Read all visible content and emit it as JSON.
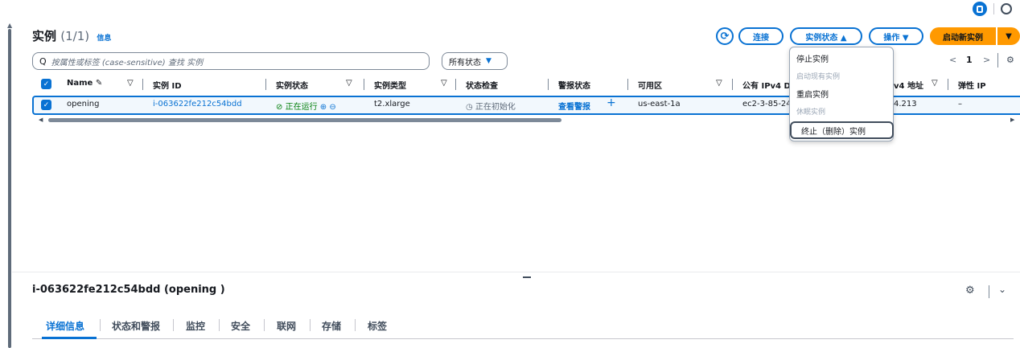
{
  "instances_title": "实例",
  "instances_count": "(1/1)",
  "info_label": "信息",
  "buttons": {
    "refresh": "⟳",
    "connect": "连接",
    "instance_state": "实例状态 ▲",
    "actions": "操作 ▼",
    "launch": "启动新实例",
    "launch_caret": "▼"
  },
  "search": {
    "icon": "search-icon",
    "placeholder": "按属性或标签 (case-sensitive) 查找 实例"
  },
  "state_filter": {
    "label": "所有状态",
    "caret": "▼"
  },
  "pager": {
    "prev": "<",
    "page": "1",
    "next": ">"
  },
  "columns": [
    "Name",
    "实例 ID",
    "实例状态",
    "实例类型",
    "状态检查",
    "警报状态",
    "可用区",
    "公有 IPv4 D",
    "v4 地址",
    "弹性 IP"
  ],
  "row": {
    "name": "opening",
    "instance_id": "i-063622fe212c54bdd",
    "state": "正在运行",
    "type": "t2.xlarge",
    "status_check": "正在初始化",
    "alarm": "查看警报",
    "alarm_add": "+",
    "az": "us-east-1a",
    "public_dns": "ec2-3-85-24",
    "ipv4": "4.213",
    "elastic_ip": "–"
  },
  "state_menu": {
    "items": [
      "停止实例",
      "启动现有实例",
      "重启实例",
      "休眠实例",
      "终止（删除）实例"
    ]
  },
  "detail": {
    "title": "i-063622fe212c54bdd (opening )",
    "tabs": [
      "详细信息",
      "状态和警报",
      "监控",
      "安全",
      "联网",
      "存储",
      "标签"
    ]
  },
  "colors": {
    "accent": "#0972d3",
    "orange": "#ff9900",
    "green": "#037f0c"
  }
}
